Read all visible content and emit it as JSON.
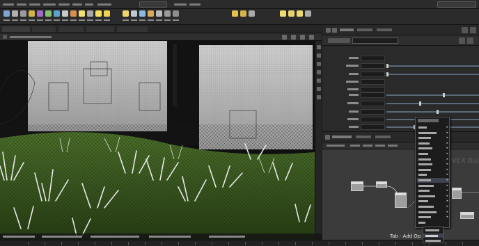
{
  "menubar": {
    "items": [
      "",
      "",
      "",
      "",
      "",
      "",
      "",
      "",
      "",
      ""
    ],
    "search_value": "",
    "right_field": ""
  },
  "shelf": {
    "tools": [
      {
        "icon": "sphere-icon",
        "color": "#7fa4d8"
      },
      {
        "icon": "box-icon",
        "color": "#b0b0b0"
      },
      {
        "icon": "grid-icon",
        "color": "#9c9c9c"
      },
      {
        "icon": "torus-icon",
        "color": "#d2b44a"
      },
      {
        "icon": "curve-icon",
        "color": "#a06ac9"
      },
      {
        "icon": "path-icon",
        "color": "#7fc26a"
      },
      {
        "icon": "circle-icon",
        "color": "#5aa3d1"
      },
      {
        "icon": "text-icon",
        "color": "#c7c7c7"
      },
      {
        "icon": "platonic-icon",
        "color": "#d9904f"
      },
      {
        "icon": "light-icon",
        "color": "#f1de74"
      },
      {
        "icon": "camera-icon",
        "color": "#a8a8a8"
      },
      {
        "icon": "point-light-icon",
        "color": "#f3e05c"
      },
      {
        "icon": "spot-light-icon",
        "color": "#f0d24e"
      },
      {
        "icon": "area-light-icon",
        "color": "#ecd768"
      },
      {
        "icon": "env-light-icon",
        "color": "#bfc8d6"
      },
      {
        "icon": "sky-light-icon",
        "color": "#8db7e0"
      },
      {
        "icon": "portal-light-icon",
        "color": "#d7a95c"
      },
      {
        "icon": "ambient-light-icon",
        "color": "#b9b9b9"
      },
      {
        "icon": "stereo-camera-icon",
        "color": "#9a9a9a"
      },
      {
        "icon": "vr-camera-icon",
        "color": "#8e8e8e"
      }
    ]
  },
  "viewport": {
    "tabs": [
      "",
      "",
      "",
      "",
      ""
    ],
    "path": "",
    "status_segments": [
      "",
      "",
      "",
      "",
      ""
    ]
  },
  "params": {
    "tabs": [
      "",
      "",
      ""
    ],
    "node_name": "",
    "rows": [
      {
        "label": "",
        "value": "",
        "slider": null
      },
      {
        "label": "",
        "value": "",
        "slider": 0.0
      },
      {
        "label": "",
        "value": "",
        "slider": 0.0
      },
      {
        "label": "",
        "value": "",
        "slider": null
      },
      {
        "label": "",
        "value": "",
        "slider": null
      },
      {
        "label": "",
        "value": "",
        "slider": 0.62
      },
      {
        "label": "",
        "value": "",
        "slider": 0.36
      },
      {
        "label": "",
        "value": "",
        "slider": 0.55
      },
      {
        "label": "",
        "value": "",
        "slider": 0.4
      },
      {
        "label": "",
        "value": "",
        "slider": 0.3
      }
    ]
  },
  "network": {
    "tabs": [
      "",
      "",
      ""
    ],
    "path": "",
    "context_watermark": "VEX Bui",
    "tab_hint": "Tab · Add Op",
    "menu_items": [
      {
        "label": "",
        "submenu": true
      },
      {
        "label": "",
        "submenu": true
      },
      {
        "label": "",
        "submenu": true
      },
      {
        "label": "",
        "submenu": true
      },
      {
        "label": "",
        "submenu": true
      },
      {
        "label": "",
        "submenu": true
      },
      {
        "label": "",
        "submenu": true
      },
      {
        "label": "",
        "submenu": true
      },
      {
        "label": "",
        "submenu": true
      },
      {
        "label": "",
        "submenu": true
      },
      {
        "label": "",
        "submenu": true
      },
      {
        "label": "",
        "submenu": true
      },
      {
        "label": "",
        "submenu": true
      },
      {
        "label": "",
        "submenu": true
      },
      {
        "label": "",
        "submenu": true
      },
      {
        "label": "",
        "submenu": true
      },
      {
        "label": "",
        "submenu": true
      },
      {
        "label": "",
        "submenu": true
      },
      {
        "label": "",
        "submenu": false
      }
    ],
    "submenu_items": [
      "",
      "",
      ""
    ]
  }
}
